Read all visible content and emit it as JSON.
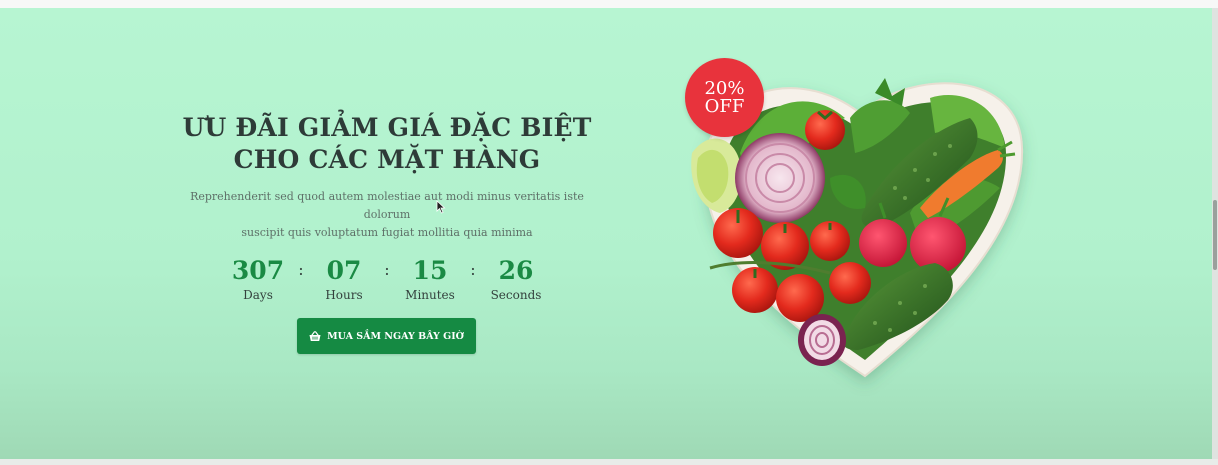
{
  "promo": {
    "title_line1": "ƯU ĐÃI GIẢM GIÁ ĐẶC BIỆT",
    "title_line2": "CHO CÁC MẶT HÀNG",
    "description_line1": "Reprehenderit sed quod autem molestiae aut modi minus veritatis iste dolorum",
    "description_line2": "suscipit quis voluptatum fugiat mollitia quia minima"
  },
  "countdown": {
    "days": "307",
    "days_label": "Days",
    "hours": "07",
    "hours_label": "Hours",
    "minutes": "15",
    "minutes_label": "Minutes",
    "seconds": "26",
    "seconds_label": "Seconds",
    "separator": ":"
  },
  "cta": {
    "label": "MUA SẮM NGAY BÂY GIỜ",
    "icon": "basket-icon"
  },
  "badge": {
    "line1": "20%",
    "line2": "OFF"
  },
  "colors": {
    "banner_bg": "#b5f4d1",
    "accent_green": "#158a43",
    "badge_red": "#e8333c",
    "title_text": "#2e3b38"
  }
}
